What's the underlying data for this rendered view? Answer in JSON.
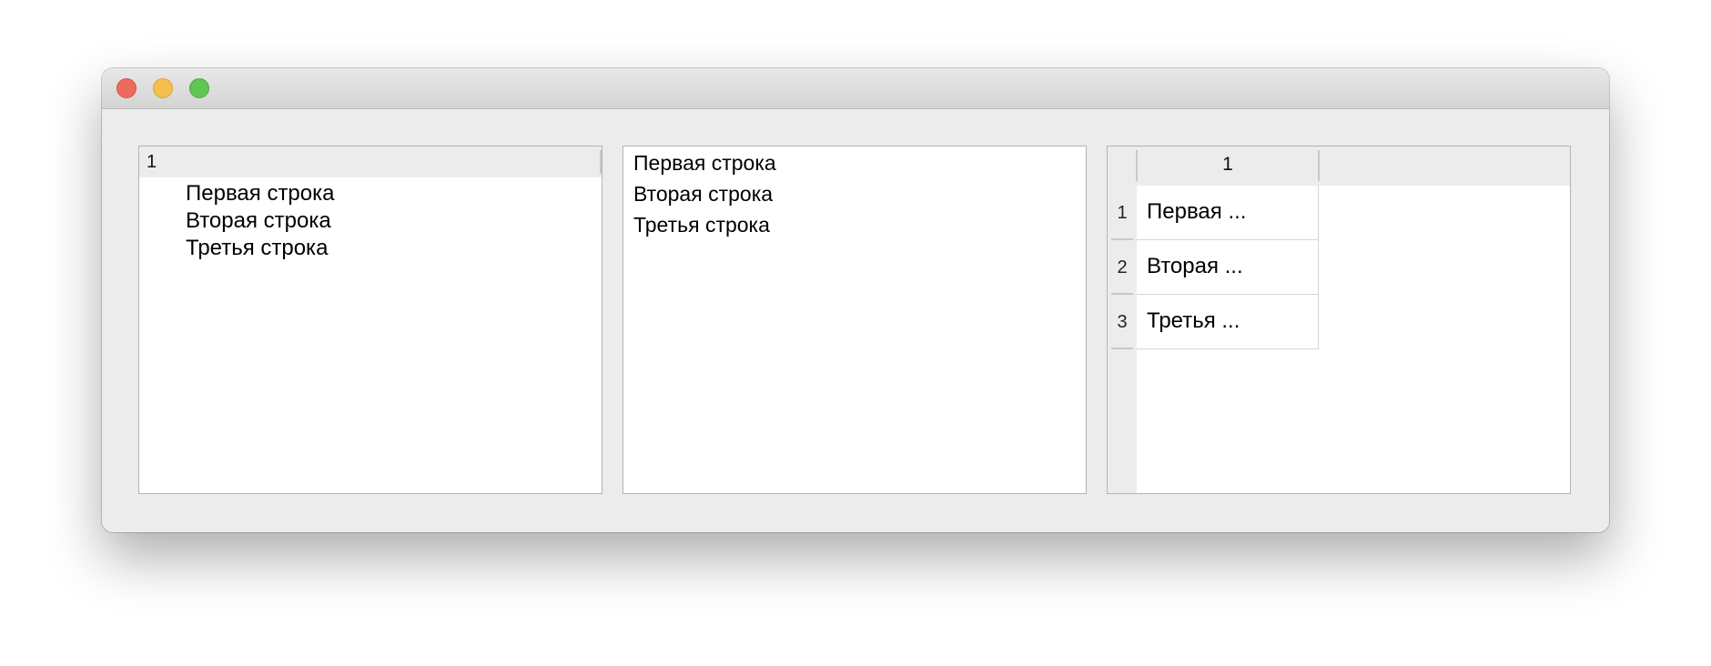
{
  "window": {
    "buttons": {
      "close": "close-button",
      "minimize": "minimize-button",
      "zoom": "zoom-button"
    }
  },
  "tree": {
    "header": "1",
    "items": [
      "Первая строка",
      "Вторая строка",
      "Третья строка"
    ]
  },
  "list": {
    "items": [
      "Первая строка",
      "Вторая строка",
      "Третья строка"
    ]
  },
  "table": {
    "column_header": "1",
    "row_headers": [
      "1",
      "2",
      "3"
    ],
    "cells": [
      "Первая ...",
      "Вторая ...",
      "Третья ..."
    ]
  },
  "colors": {
    "close": "#ed6a5e",
    "minimize": "#f5bf4f",
    "zoom": "#61c554",
    "window_bg": "#ececec"
  }
}
